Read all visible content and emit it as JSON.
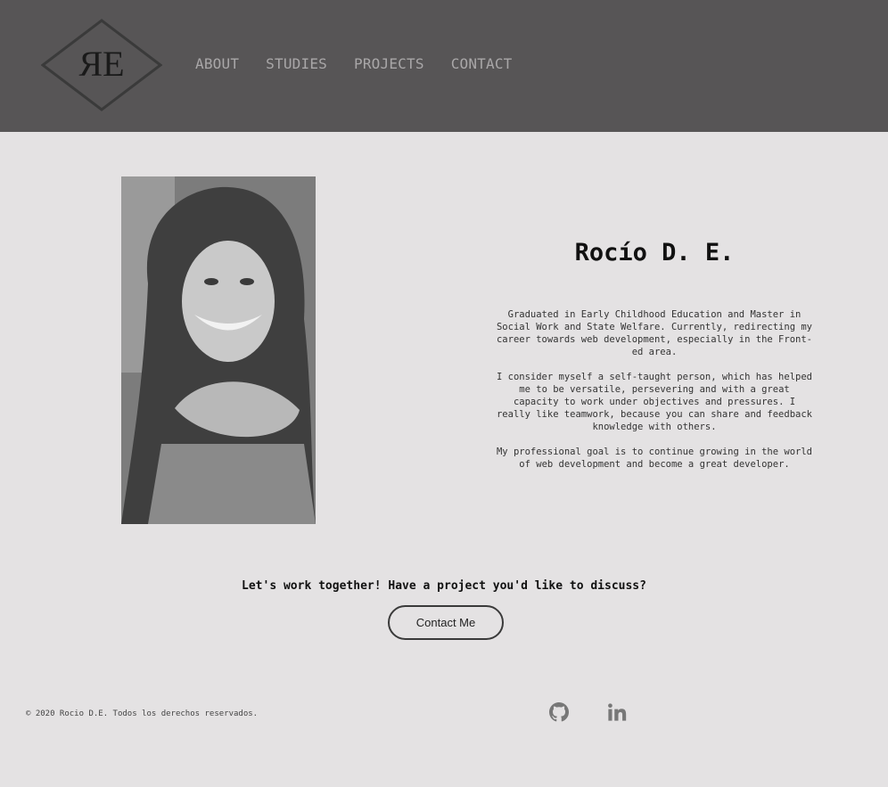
{
  "logo": {
    "text": "ЯE"
  },
  "nav": {
    "items": [
      {
        "label": "ABOUT"
      },
      {
        "label": "STUDIES"
      },
      {
        "label": "PROJECTS"
      },
      {
        "label": "CONTACT"
      }
    ]
  },
  "profile": {
    "name": "Rocío D. E.",
    "bio": [
      "Graduated in Early Childhood Education and Master in Social Work and State Welfare. Currently, redirecting my career towards web development, especially in the Front-ed area.",
      "I consider myself a self-taught person, which has helped me to be versatile, persevering and with a great capacity to work under objectives and pressures. I really like teamwork, because you can share and feedback knowledge with others.",
      "My professional goal is to continue growing in the world of web development and become a great developer."
    ]
  },
  "cta": {
    "text": "Let's work together! Have a project you'd like to discuss?",
    "button_label": "Contact Me"
  },
  "footer": {
    "copyright": "© 2020 Rocio D.E. Todos los derechos reservados.",
    "social": [
      {
        "icon": "github-icon"
      },
      {
        "icon": "linkedin-icon"
      }
    ]
  },
  "colors": {
    "header_bg": "#575556",
    "page_bg": "#e4e2e3",
    "nav_text": "#a9a7a8"
  }
}
